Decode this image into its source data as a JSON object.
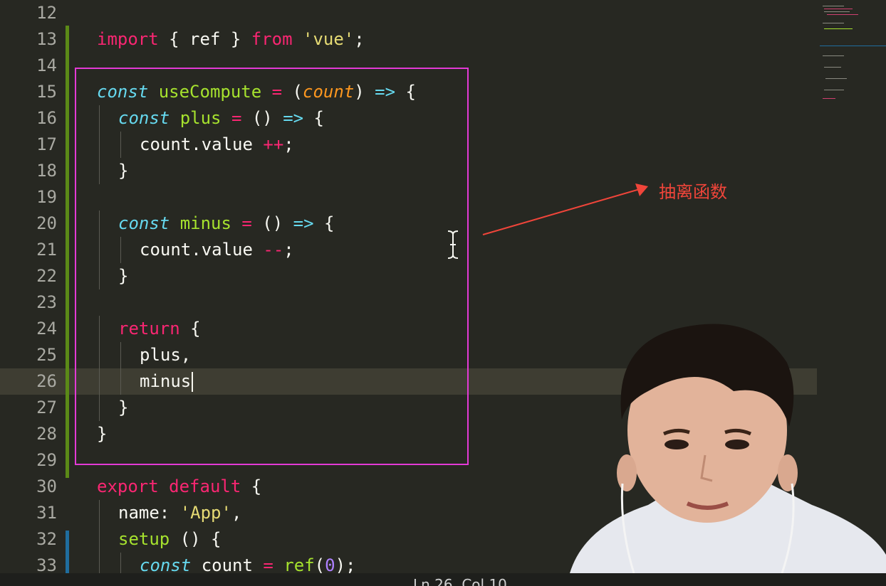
{
  "editor": {
    "lines": [
      {
        "number": "12",
        "indent": 0,
        "tokens": []
      },
      {
        "number": "13",
        "indent": 0,
        "tokens": [
          {
            "t": "import",
            "c": "kw"
          },
          {
            "t": " { ref } ",
            "c": ""
          },
          {
            "t": "from",
            "c": "kw"
          },
          {
            "t": " ",
            "c": ""
          },
          {
            "t": "'vue'",
            "c": "str"
          },
          {
            "t": ";",
            "c": ""
          }
        ]
      },
      {
        "number": "14",
        "indent": 0,
        "tokens": []
      },
      {
        "number": "15",
        "indent": 0,
        "tokens": [
          {
            "t": "const",
            "c": "kwi"
          },
          {
            "t": " ",
            "c": ""
          },
          {
            "t": "useCompute",
            "c": "fn"
          },
          {
            "t": " ",
            "c": ""
          },
          {
            "t": "=",
            "c": "op"
          },
          {
            "t": " (",
            "c": ""
          },
          {
            "t": "count",
            "c": "param"
          },
          {
            "t": ") ",
            "c": ""
          },
          {
            "t": "=>",
            "c": "arrowop"
          },
          {
            "t": " {",
            "c": ""
          }
        ]
      },
      {
        "number": "16",
        "indent": 1,
        "tokens": [
          {
            "t": "const",
            "c": "kwi"
          },
          {
            "t": " ",
            "c": ""
          },
          {
            "t": "plus",
            "c": "fn"
          },
          {
            "t": " ",
            "c": ""
          },
          {
            "t": "=",
            "c": "op"
          },
          {
            "t": " () ",
            "c": ""
          },
          {
            "t": "=>",
            "c": "arrowop"
          },
          {
            "t": " {",
            "c": ""
          }
        ]
      },
      {
        "number": "17",
        "indent": 2,
        "tokens": [
          {
            "t": "count.value ",
            "c": ""
          },
          {
            "t": "++",
            "c": "op"
          },
          {
            "t": ";",
            "c": ""
          }
        ]
      },
      {
        "number": "18",
        "indent": 1,
        "tokens": [
          {
            "t": "}",
            "c": ""
          }
        ]
      },
      {
        "number": "19",
        "indent": 0,
        "tokens": []
      },
      {
        "number": "20",
        "indent": 1,
        "tokens": [
          {
            "t": "const",
            "c": "kwi"
          },
          {
            "t": " ",
            "c": ""
          },
          {
            "t": "minus",
            "c": "fn"
          },
          {
            "t": " ",
            "c": ""
          },
          {
            "t": "=",
            "c": "op"
          },
          {
            "t": " () ",
            "c": ""
          },
          {
            "t": "=>",
            "c": "arrowop"
          },
          {
            "t": " {",
            "c": ""
          }
        ]
      },
      {
        "number": "21",
        "indent": 2,
        "tokens": [
          {
            "t": "count.value ",
            "c": ""
          },
          {
            "t": "--",
            "c": "op"
          },
          {
            "t": ";",
            "c": ""
          }
        ]
      },
      {
        "number": "22",
        "indent": 1,
        "tokens": [
          {
            "t": "}",
            "c": ""
          }
        ]
      },
      {
        "number": "23",
        "indent": 0,
        "tokens": []
      },
      {
        "number": "24",
        "indent": 1,
        "tokens": [
          {
            "t": "return",
            "c": "kw"
          },
          {
            "t": " {",
            "c": ""
          }
        ]
      },
      {
        "number": "25",
        "indent": 2,
        "tokens": [
          {
            "t": "plus,",
            "c": ""
          }
        ]
      },
      {
        "number": "26",
        "indent": 2,
        "tokens": [
          {
            "t": "minus",
            "c": ""
          }
        ],
        "active": true,
        "caret": true
      },
      {
        "number": "27",
        "indent": 1,
        "tokens": [
          {
            "t": "}",
            "c": ""
          }
        ]
      },
      {
        "number": "28",
        "indent": 0,
        "tokens": [
          {
            "t": "}",
            "c": ""
          }
        ]
      },
      {
        "number": "29",
        "indent": 0,
        "tokens": []
      },
      {
        "number": "30",
        "indent": 0,
        "tokens": [
          {
            "t": "export",
            "c": "kw"
          },
          {
            "t": " ",
            "c": ""
          },
          {
            "t": "default",
            "c": "kw"
          },
          {
            "t": " {",
            "c": ""
          }
        ]
      },
      {
        "number": "31",
        "indent": 1,
        "tokens": [
          {
            "t": "name: ",
            "c": ""
          },
          {
            "t": "'App'",
            "c": "str"
          },
          {
            "t": ",",
            "c": ""
          }
        ]
      },
      {
        "number": "32",
        "indent": 1,
        "tokens": [
          {
            "t": "setup",
            "c": "fn"
          },
          {
            "t": " () {",
            "c": ""
          }
        ]
      },
      {
        "number": "33",
        "indent": 2,
        "tokens": [
          {
            "t": "const",
            "c": "kwi"
          },
          {
            "t": " count ",
            "c": ""
          },
          {
            "t": "=",
            "c": "op"
          },
          {
            "t": " ",
            "c": ""
          },
          {
            "t": "ref",
            "c": "fn"
          },
          {
            "t": "(",
            "c": ""
          },
          {
            "t": "0",
            "c": "num"
          },
          {
            "t": ");",
            "c": ""
          }
        ]
      }
    ]
  },
  "annotation": {
    "label": "抽离函数",
    "color": "#f0453a",
    "box_color": "#e33ad6"
  },
  "statusbar": {
    "cursor_position": "Ln 26, Col 10"
  },
  "colors": {
    "background": "#272822",
    "keyword": "#f92672",
    "storage": "#66d9ef",
    "function": "#a6e22e",
    "string": "#e6db74",
    "parameter": "#fd971f",
    "git_added": "#5b8a17",
    "git_modified": "#1f6d9e"
  },
  "icons": {
    "cursor": "i-beam-cursor-icon",
    "arrow": "annotation-arrow-icon"
  }
}
